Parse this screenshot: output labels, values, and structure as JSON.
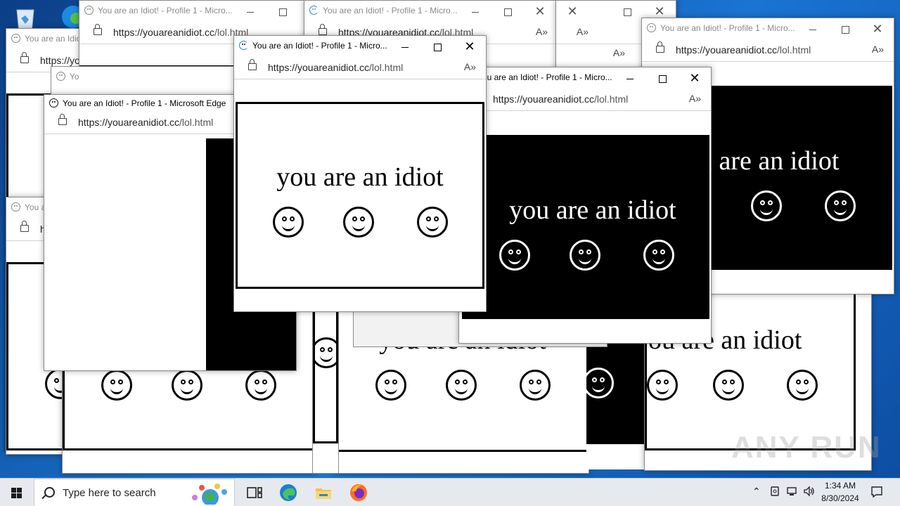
{
  "browser": {
    "title_full": "You are an Idiot! - Profile 1 - Microsoft Edge",
    "title_short": "You are an Idiot! - Profile 1 - Micro...",
    "title_tiny_1": "You are an Idiot",
    "title_tiny_2": "You a",
    "title_tiny_3": "Yo",
    "url_host": "https://youareanidiot.cc",
    "url_path": "/lol.html",
    "url_trunc": "https://yo",
    "url_h": "h"
  },
  "page": {
    "message": "you are an idiot",
    "message_partial": "u are an idiot",
    "message_partial2": "ou are an idiot"
  },
  "taskbar": {
    "search_placeholder": "Type here to search",
    "time": "1:34 AM",
    "date": "8/30/2024"
  },
  "icons": {
    "start": "windows-logo-icon",
    "search": "search-icon",
    "task_view": "task-view-icon",
    "edge": "edge-icon",
    "explorer": "file-explorer-icon",
    "firefox": "firefox-icon",
    "recycle_bin": "recycle-bin-icon"
  },
  "watermark": "ANY RUN",
  "colors": {
    "accent": "#0078d4",
    "idiot_bg_black": "#000000",
    "idiot_bg_white": "#ffffff"
  }
}
